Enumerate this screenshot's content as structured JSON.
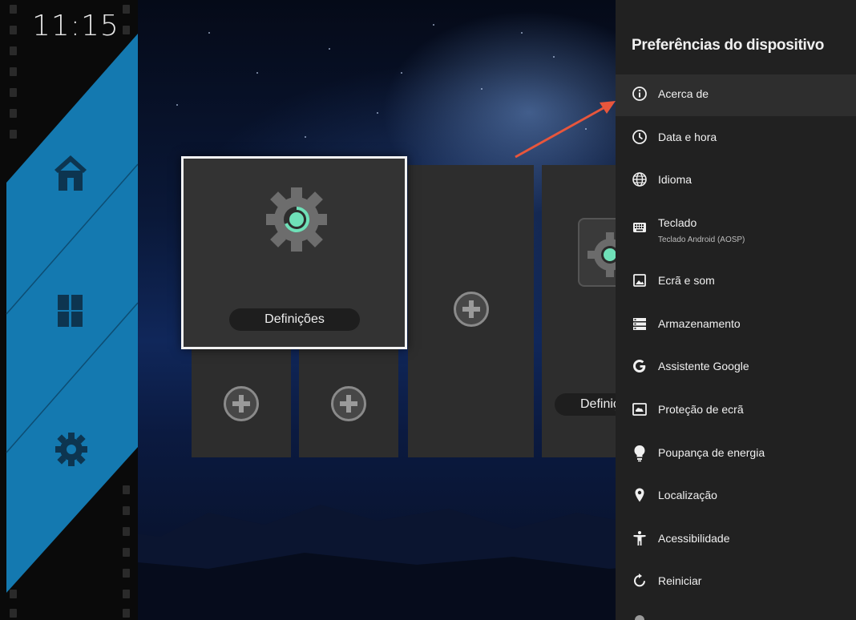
{
  "status": {
    "clock": "11:15"
  },
  "launcher": {
    "sidebar": [
      {
        "name": "home",
        "icon": "home-icon"
      },
      {
        "name": "apps",
        "icon": "apps-grid-icon"
      },
      {
        "name": "settings",
        "icon": "gear-icon"
      }
    ],
    "tiles": {
      "focused_label": "Definições",
      "partial_label": "Definiçõ"
    }
  },
  "settings_panel": {
    "title": "Preferências do dispositivo",
    "items": [
      {
        "label": "Acerca de",
        "icon": "info-icon"
      },
      {
        "label": "Data e hora",
        "icon": "clock-icon"
      },
      {
        "label": "Idioma",
        "icon": "globe-icon"
      },
      {
        "label": "Teclado",
        "sub": "Teclado Android (AOSP)",
        "icon": "keyboard-icon"
      },
      {
        "label": "Ecrã e som",
        "icon": "image-icon"
      },
      {
        "label": "Armazenamento",
        "icon": "storage-icon"
      },
      {
        "label": "Assistente Google",
        "icon": "google-icon"
      },
      {
        "label": "Proteção de ecrã",
        "icon": "screensaver-icon"
      },
      {
        "label": "Poupança de energia",
        "icon": "lightbulb-icon"
      },
      {
        "label": "Localização",
        "icon": "location-pin-icon"
      },
      {
        "label": "Acessibilidade",
        "icon": "accessibility-icon"
      },
      {
        "label": "Reiniciar",
        "icon": "restart-icon"
      }
    ]
  },
  "colors": {
    "panel_bg": "#212121",
    "sidebar_blue": "#1479b0",
    "gear_accent": "#6fe0b8",
    "annotation_arrow": "#e8563c"
  }
}
